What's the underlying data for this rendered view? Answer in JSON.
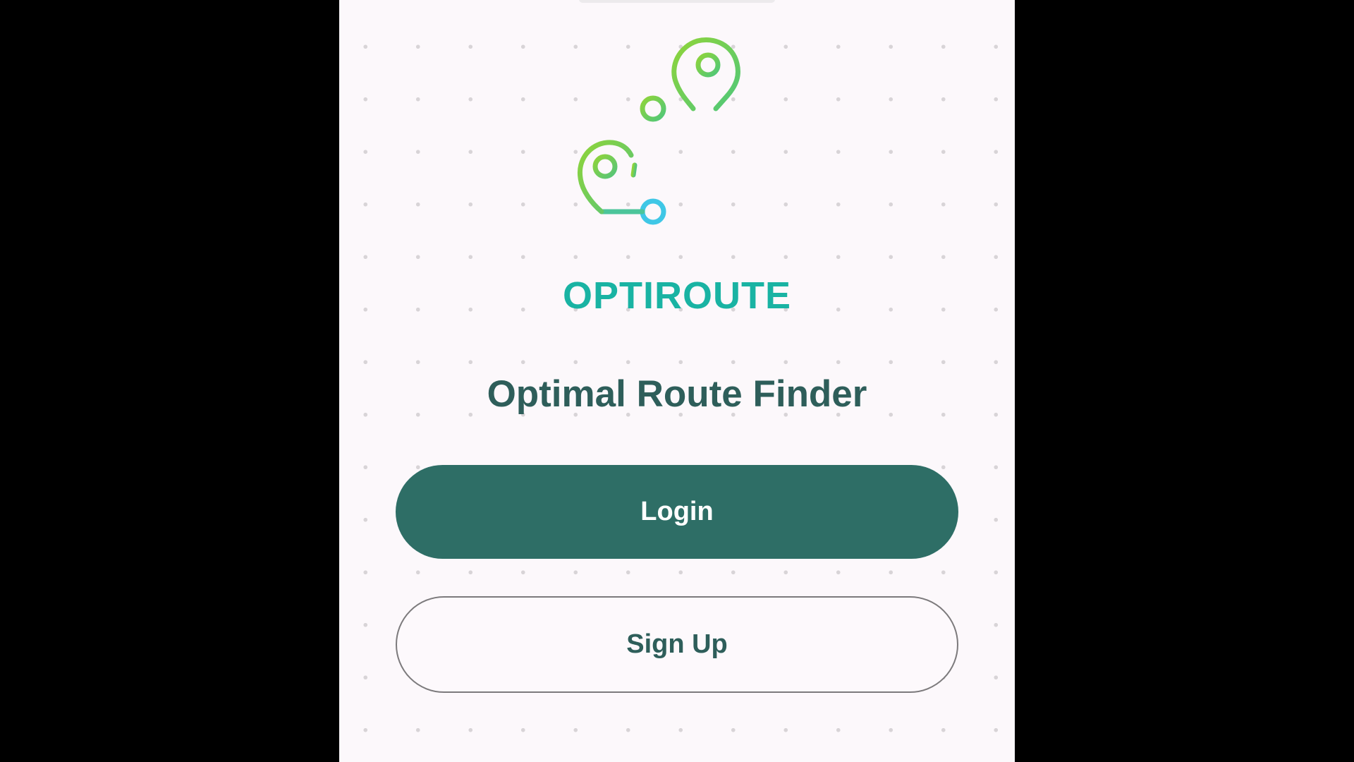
{
  "app": {
    "brand_name": "OPTIROUTE",
    "tagline": "Optimal Route Finder",
    "logo_icon": "route-map-pins-icon"
  },
  "actions": {
    "login_label": "Login",
    "signup_label": "Sign Up"
  },
  "colors": {
    "brand_teal": "#19b3a3",
    "primary_button": "#2e6e66",
    "text_dark_green": "#2e5e5a",
    "logo_gradient_start": "#8fd43a",
    "logo_gradient_end": "#3fc7e6"
  }
}
